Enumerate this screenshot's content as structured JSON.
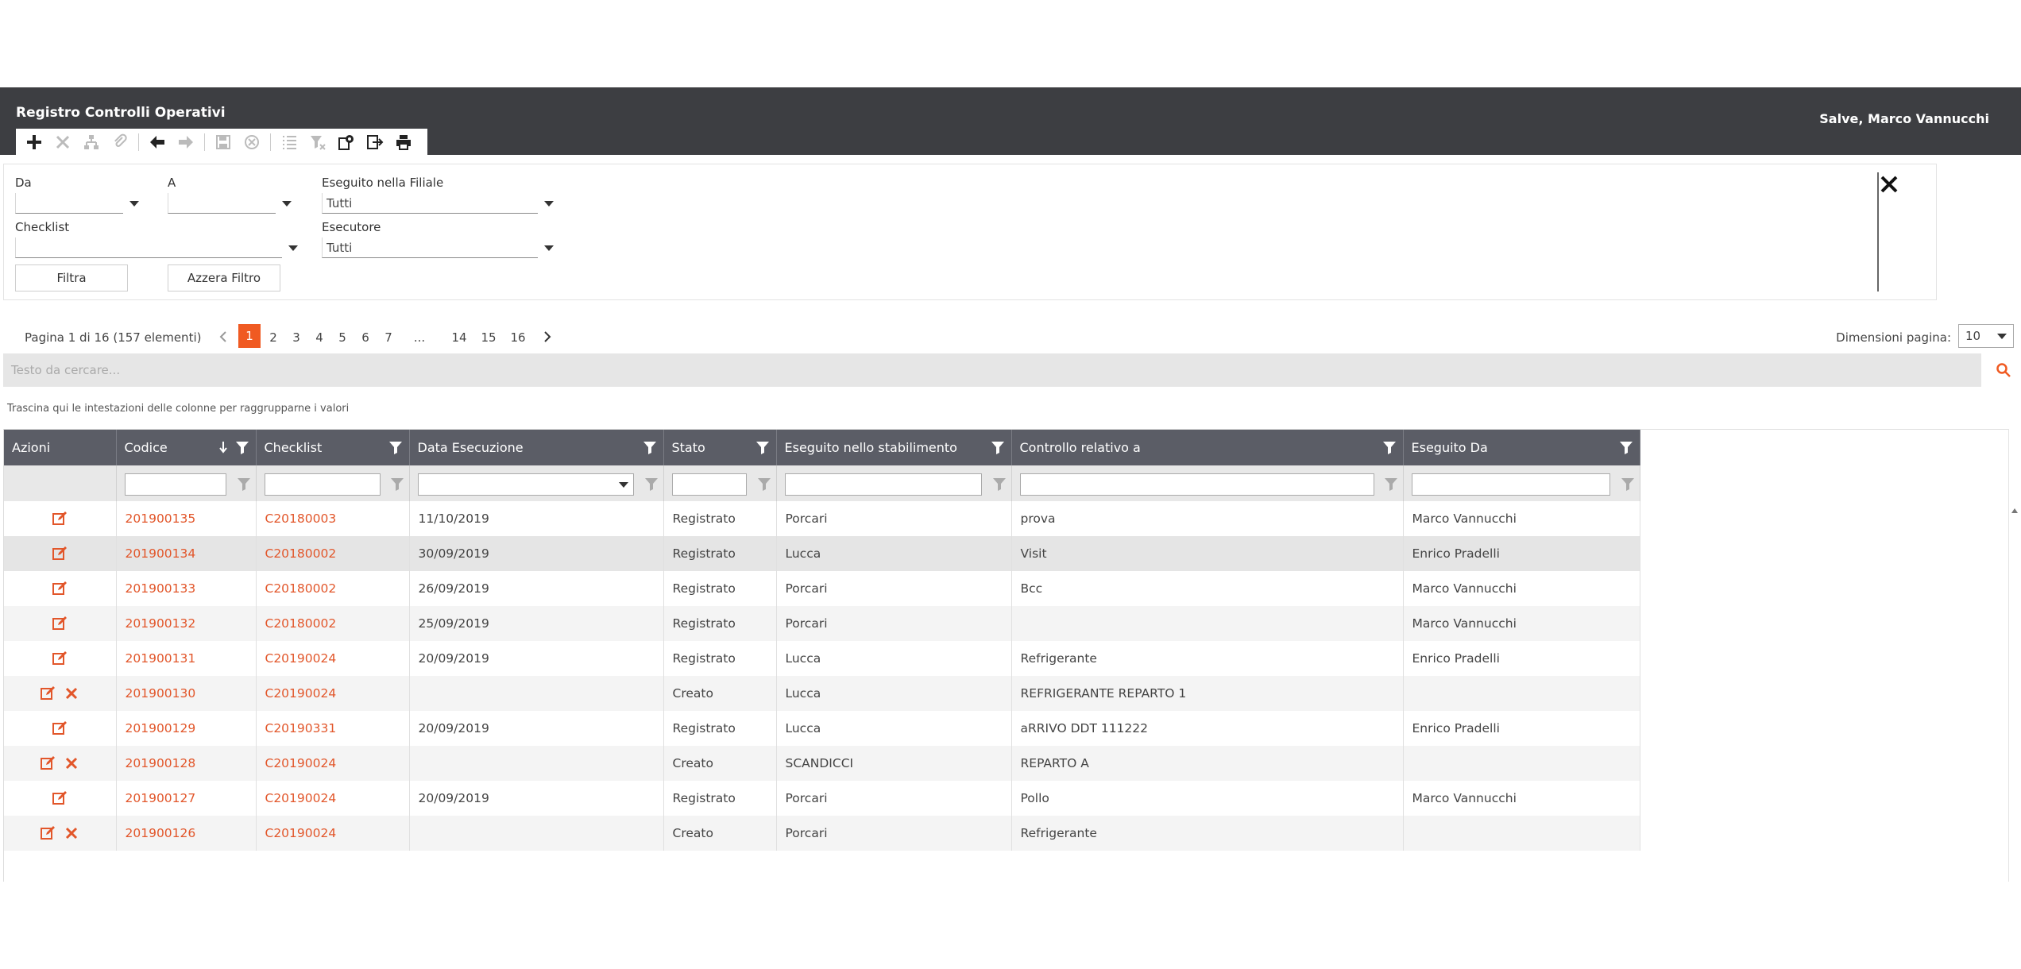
{
  "header": {
    "title": "Registro Controlli Operativi",
    "greeting": "Salve, Marco Vannucchi"
  },
  "toolbar": {
    "icons": [
      "plus-icon",
      "delete-icon",
      "hierarchy-icon",
      "attach-icon",
      "arrow-left-icon",
      "arrow-right-icon",
      "save-icon",
      "cancel-icon",
      "list-icon",
      "filter-clear-icon",
      "settings-icon",
      "export-icon",
      "print-icon"
    ]
  },
  "filters": {
    "da_label": "Da",
    "da_value": "",
    "a_label": "A",
    "a_value": "",
    "filiale_label": "Eseguito nella Filiale",
    "filiale_value": "Tutti",
    "checklist_label": "Checklist",
    "checklist_value": "",
    "esecutore_label": "Esecutore",
    "esecutore_value": "Tutti",
    "filter_button": "Filtra",
    "reset_button": "Azzera Filtro"
  },
  "pager": {
    "info": "Pagina 1 di 16 (157 elementi)",
    "pages": [
      "1",
      "2",
      "3",
      "4",
      "5",
      "6",
      "7",
      "...",
      "14",
      "15",
      "16"
    ],
    "current": "1",
    "page_size_label": "Dimensioni pagina:",
    "page_size": "10"
  },
  "search": {
    "placeholder": "Testo da cercare..."
  },
  "group_hint": "Trascina qui le intestazioni delle colonne per raggrupparne i valori",
  "grid": {
    "columns": [
      "Azioni",
      "Codice",
      "Checklist",
      "Data Esecuzione",
      "Stato",
      "Eseguito nello stabilimento",
      "Controllo relativo a",
      "Eseguito Da"
    ],
    "rows": [
      {
        "codice": "201900135",
        "checklist": "C20180003",
        "data": "11/10/2019",
        "stato": "Registrato",
        "stabilimento": "Porcari",
        "controllo": "prova",
        "eseguito_da": "Marco Vannucchi",
        "deletable": false
      },
      {
        "codice": "201900134",
        "checklist": "C20180002",
        "data": "30/09/2019",
        "stato": "Registrato",
        "stabilimento": "Lucca",
        "controllo": "Visit",
        "eseguito_da": "Enrico Pradelli",
        "deletable": false
      },
      {
        "codice": "201900133",
        "checklist": "C20180002",
        "data": "26/09/2019",
        "stato": "Registrato",
        "stabilimento": "Porcari",
        "controllo": "Bcc",
        "eseguito_da": "Marco Vannucchi",
        "deletable": false
      },
      {
        "codice": "201900132",
        "checklist": "C20180002",
        "data": "25/09/2019",
        "stato": "Registrato",
        "stabilimento": "Porcari",
        "controllo": "",
        "eseguito_da": "Marco Vannucchi",
        "deletable": false
      },
      {
        "codice": "201900131",
        "checklist": "C20190024",
        "data": "20/09/2019",
        "stato": "Registrato",
        "stabilimento": "Lucca",
        "controllo": "Refrigerante",
        "eseguito_da": "Enrico Pradelli",
        "deletable": false
      },
      {
        "codice": "201900130",
        "checklist": "C20190024",
        "data": "",
        "stato": "Creato",
        "stabilimento": "Lucca",
        "controllo": "REFRIGERANTE REPARTO 1",
        "eseguito_da": "",
        "deletable": true
      },
      {
        "codice": "201900129",
        "checklist": "C20190331",
        "data": "20/09/2019",
        "stato": "Registrato",
        "stabilimento": "Lucca",
        "controllo": "aRRIVO DDT 111222",
        "eseguito_da": "Enrico Pradelli",
        "deletable": false
      },
      {
        "codice": "201900128",
        "checklist": "C20190024",
        "data": "",
        "stato": "Creato",
        "stabilimento": "SCANDICCI",
        "controllo": "REPARTO A",
        "eseguito_da": "",
        "deletable": true
      },
      {
        "codice": "201900127",
        "checklist": "C20190024",
        "data": "20/09/2019",
        "stato": "Registrato",
        "stabilimento": "Porcari",
        "controllo": "Pollo",
        "eseguito_da": "Marco Vannucchi",
        "deletable": false
      },
      {
        "codice": "201900126",
        "checklist": "C20190024",
        "data": "",
        "stato": "Creato",
        "stabilimento": "Porcari",
        "controllo": "Refrigerante",
        "eseguito_da": "",
        "deletable": true
      }
    ]
  },
  "colors": {
    "header_bg": "#3d3e42",
    "grid_header_bg": "#5b5d66",
    "accent": "#e2562a",
    "active_page": "#f05a22"
  }
}
